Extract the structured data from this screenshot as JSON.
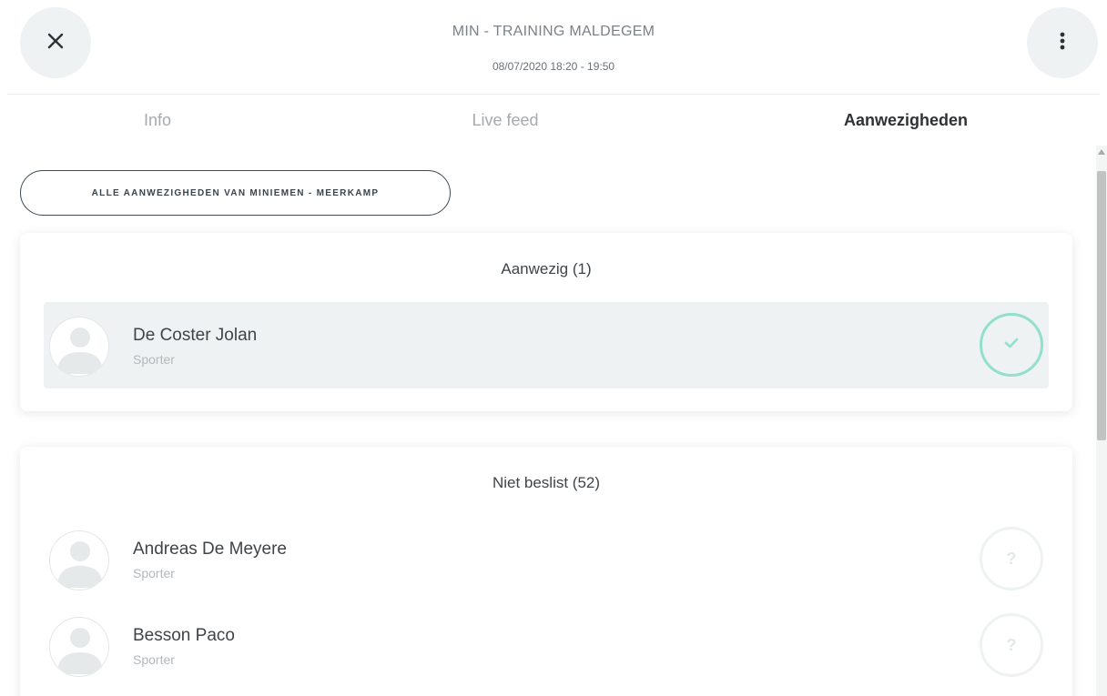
{
  "header": {
    "title": "MIN - TRAINING MALDEGEM",
    "datetime": "08/07/2020 18:20 - 19:50"
  },
  "tabs": [
    {
      "label": "Info",
      "active": false
    },
    {
      "label": "Live feed",
      "active": false
    },
    {
      "label": "Aanwezigheden",
      "active": true
    }
  ],
  "all_attendance_button": "ALLE AANWEZIGHEDEN VAN MINIEMEN - MEERKAMP",
  "present": {
    "heading": "Aanwezig (1)",
    "members": [
      {
        "name": "De Coster Jolan",
        "role": "Sporter",
        "status": "check-icon"
      }
    ]
  },
  "undecided": {
    "heading": "Niet beslist (52)",
    "members": [
      {
        "name": "Andreas De Meyere",
        "role": "Sporter",
        "status": "?"
      },
      {
        "name": "Besson Paco",
        "role": "Sporter",
        "status": "?"
      }
    ]
  },
  "colors": {
    "accent_present": "#92dfca",
    "row_highlight": "#eef2f2",
    "active_tab": "#2e3236"
  }
}
